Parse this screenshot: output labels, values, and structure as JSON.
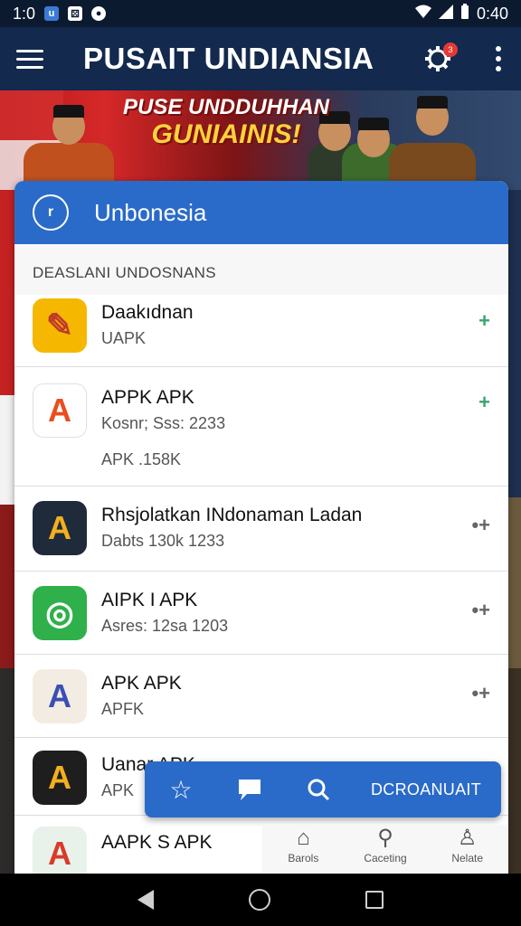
{
  "status": {
    "time_left": "1:0",
    "time_right": "0:40"
  },
  "appbar": {
    "title": "PUSAIT UNDIANSIA",
    "notification_count": "3"
  },
  "banner": {
    "line1": "PUSE UNDDUHHAN",
    "line2": "GUNIAINIS!"
  },
  "card": {
    "title": "Unbonesia",
    "logo_text": "r",
    "section_label": "DEASLANI UNDOSNANS"
  },
  "apps": [
    {
      "name": "Daakıdnan",
      "sub": "UAPK",
      "sub2": "",
      "icon_glyph": "✎",
      "icon_bg": "#f5b700",
      "icon_fg": "#c0392b",
      "action": "+"
    },
    {
      "name": "APPK APK",
      "sub": "Kosnr; Sss: 2233",
      "sub2": "APK .158K",
      "icon_glyph": "A",
      "icon_bg": "#ffffff",
      "icon_fg": "#e94e1b",
      "action": "+"
    },
    {
      "name": "Rhsjolatkan INdonaman  Ladan",
      "sub": "Dabts 130k 1233",
      "sub2": "",
      "icon_glyph": "A",
      "icon_bg": "#1f2a3a",
      "icon_fg": "#f2b01e",
      "action": "•+"
    },
    {
      "name": "AIPK I APK",
      "sub": "Asres: 12sa 1203",
      "sub2": "",
      "icon_glyph": "◎",
      "icon_bg": "#2fb04a",
      "icon_fg": "#ffffff",
      "action": "•+"
    },
    {
      "name": "APK APK",
      "sub": "APFK",
      "sub2": "",
      "icon_glyph": "A",
      "icon_bg": "#f3ece2",
      "icon_fg": "#3a4fb5",
      "action": "•+"
    },
    {
      "name": "Uanar APK",
      "sub": "APK",
      "sub2": "",
      "icon_glyph": "A",
      "icon_bg": "#1e1e1e",
      "icon_fg": "#f2b01e",
      "action": ""
    },
    {
      "name": "AAPK S APK",
      "sub": "",
      "sub2": "",
      "icon_glyph": "A",
      "icon_bg": "#e8f2ea",
      "icon_fg": "#d93a2b",
      "action": ""
    }
  ],
  "fab": {
    "label": "DCROANUAIT"
  },
  "tabs": [
    {
      "label": "Barols",
      "icon": "⌂"
    },
    {
      "label": "Caceting",
      "icon": "⚲"
    },
    {
      "label": "Nelate",
      "icon": "♙"
    }
  ],
  "colors": {
    "accent": "#2a6bc9",
    "appbar": "#13294d",
    "download_green": "#3aa56f",
    "download_gray": "#666666"
  }
}
